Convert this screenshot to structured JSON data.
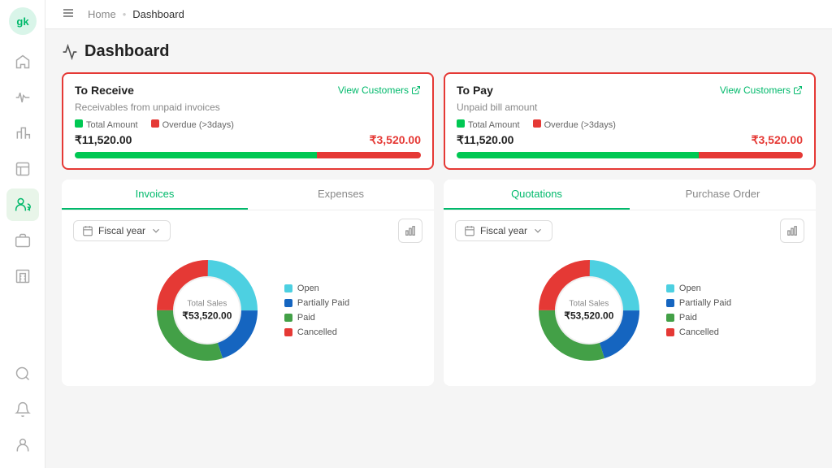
{
  "app": {
    "logo": "GK"
  },
  "breadcrumb": {
    "home": "Home",
    "separator": "•",
    "current": "Dashboard"
  },
  "page_title": "Dashboard",
  "sidebar": {
    "items": [
      {
        "id": "home",
        "icon": "home-icon"
      },
      {
        "id": "pulse",
        "icon": "pulse-icon"
      },
      {
        "id": "chart",
        "icon": "chart-icon"
      },
      {
        "id": "box",
        "icon": "box-icon"
      },
      {
        "id": "users",
        "icon": "users-icon",
        "active": true
      },
      {
        "id": "briefcase",
        "icon": "briefcase-icon"
      },
      {
        "id": "building",
        "icon": "building-icon"
      },
      {
        "id": "search",
        "icon": "search-icon"
      },
      {
        "id": "bell",
        "icon": "bell-icon"
      },
      {
        "id": "person",
        "icon": "person-icon"
      }
    ]
  },
  "summary_cards": [
    {
      "id": "to-receive",
      "title": "To Receive",
      "view_link": "View Customers",
      "subtitle": "Receivables from unpaid invoices",
      "total_amount": "₹11,520.00",
      "overdue_amount": "₹3,520.00",
      "total_label": "Total Amount",
      "overdue_label": "Overdue (>3days)",
      "progress_green": 70,
      "progress_red": 30
    },
    {
      "id": "to-pay",
      "title": "To Pay",
      "view_link": "View Customers",
      "subtitle": "Unpaid bill amount",
      "total_amount": "₹11,520.00",
      "overdue_amount": "₹3,520.00",
      "total_label": "Total Amount",
      "overdue_label": "Overdue (>3days)",
      "progress_green": 70,
      "progress_red": 30
    }
  ],
  "chart_cards": [
    {
      "id": "invoices-chart",
      "tabs": [
        "Invoices",
        "Expenses"
      ],
      "active_tab": 0,
      "filter": "Fiscal year",
      "donut": {
        "center_label": "Total Sales",
        "center_value": "₹53,520.00",
        "segments": [
          {
            "label": "Open",
            "color": "#4dd0e1",
            "value": 25
          },
          {
            "label": "Partially Paid",
            "color": "#1565c0",
            "value": 20
          },
          {
            "label": "Paid",
            "color": "#43a047",
            "value": 30
          },
          {
            "label": "Cancelled",
            "color": "#e53935",
            "value": 25
          }
        ]
      }
    },
    {
      "id": "quotations-chart",
      "tabs": [
        "Quotations",
        "Purchase Order"
      ],
      "active_tab": 0,
      "filter": "Fiscal year",
      "donut": {
        "center_label": "Total Sales",
        "center_value": "₹53,520.00",
        "segments": [
          {
            "label": "Open",
            "color": "#4dd0e1",
            "value": 25
          },
          {
            "label": "Partially Paid",
            "color": "#1565c0",
            "value": 20
          },
          {
            "label": "Paid",
            "color": "#43a047",
            "value": 30
          },
          {
            "label": "Cancelled",
            "color": "#e53935",
            "value": 25
          }
        ]
      }
    }
  ],
  "colors": {
    "green": "#00b96b",
    "red": "#e53935",
    "accent": "#00c853"
  }
}
